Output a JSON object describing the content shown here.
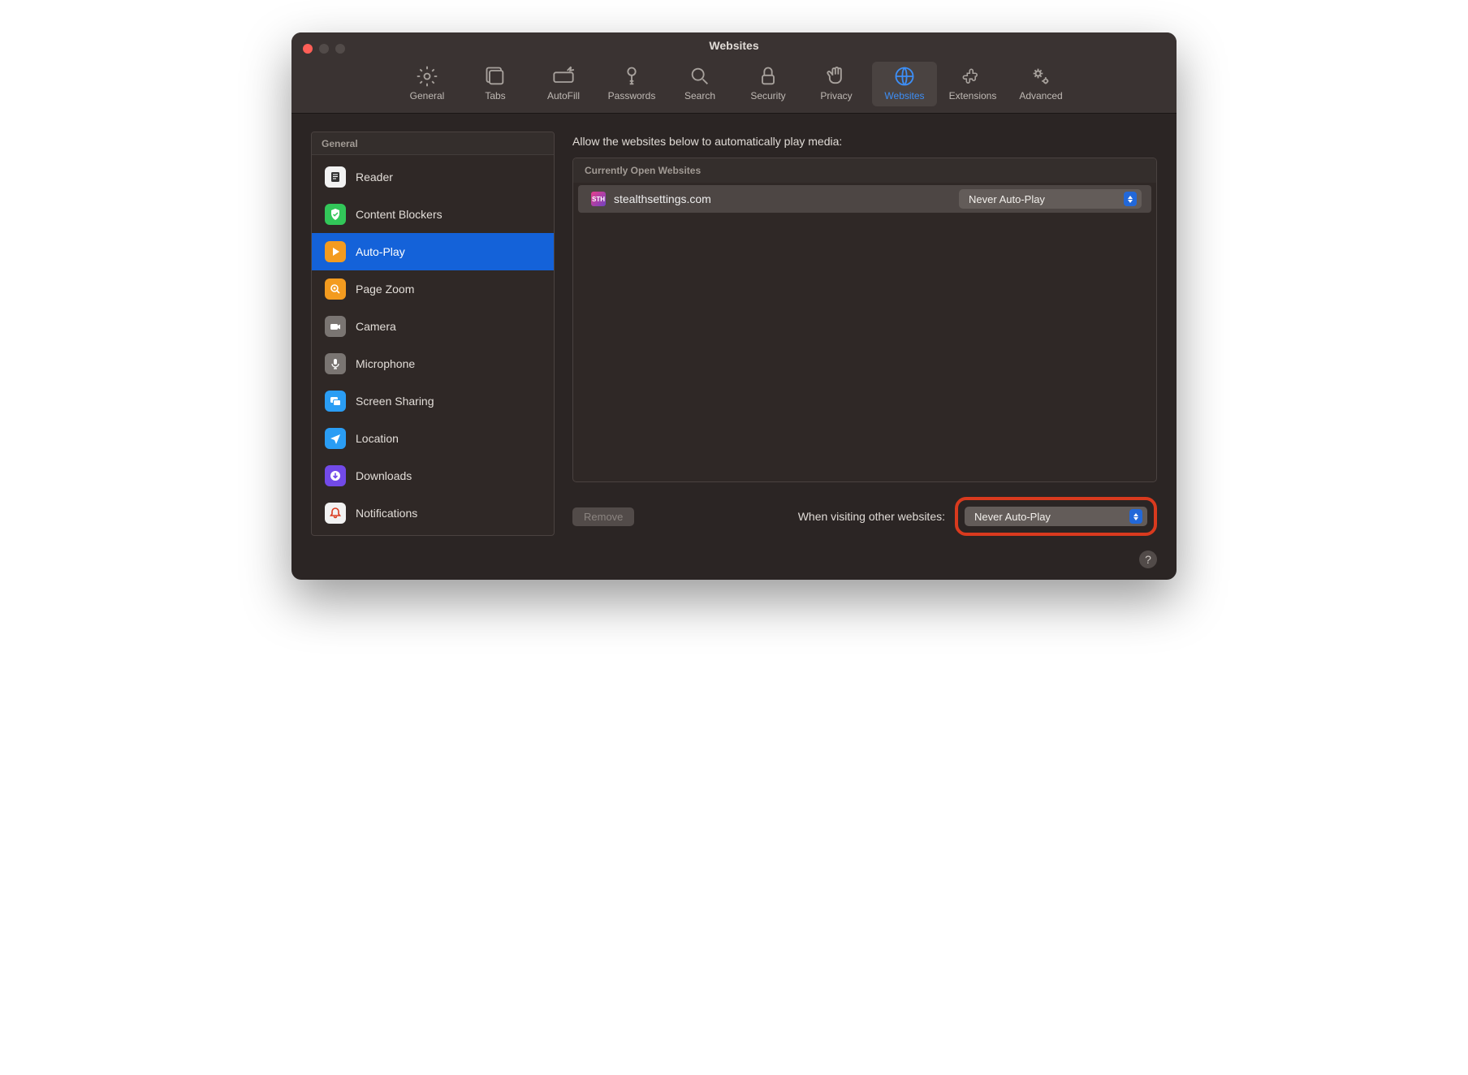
{
  "window": {
    "title": "Websites"
  },
  "toolbar": {
    "items": [
      {
        "label": "General"
      },
      {
        "label": "Tabs"
      },
      {
        "label": "AutoFill"
      },
      {
        "label": "Passwords"
      },
      {
        "label": "Search"
      },
      {
        "label": "Security"
      },
      {
        "label": "Privacy"
      },
      {
        "label": "Websites"
      },
      {
        "label": "Extensions"
      },
      {
        "label": "Advanced"
      }
    ],
    "selected": "Websites"
  },
  "sidebar": {
    "header": "General",
    "items": [
      {
        "label": "Reader"
      },
      {
        "label": "Content Blockers"
      },
      {
        "label": "Auto-Play"
      },
      {
        "label": "Page Zoom"
      },
      {
        "label": "Camera"
      },
      {
        "label": "Microphone"
      },
      {
        "label": "Screen Sharing"
      },
      {
        "label": "Location"
      },
      {
        "label": "Downloads"
      },
      {
        "label": "Notifications"
      }
    ],
    "selected": "Auto-Play"
  },
  "main": {
    "header": "Allow the websites below to automatically play media:",
    "section_header": "Currently Open Websites",
    "rows": [
      {
        "site": "stealthsettings.com",
        "value": "Never Auto-Play"
      }
    ],
    "remove_label": "Remove",
    "footer_label": "When visiting other websites:",
    "footer_value": "Never Auto-Play"
  },
  "help_label": "?"
}
